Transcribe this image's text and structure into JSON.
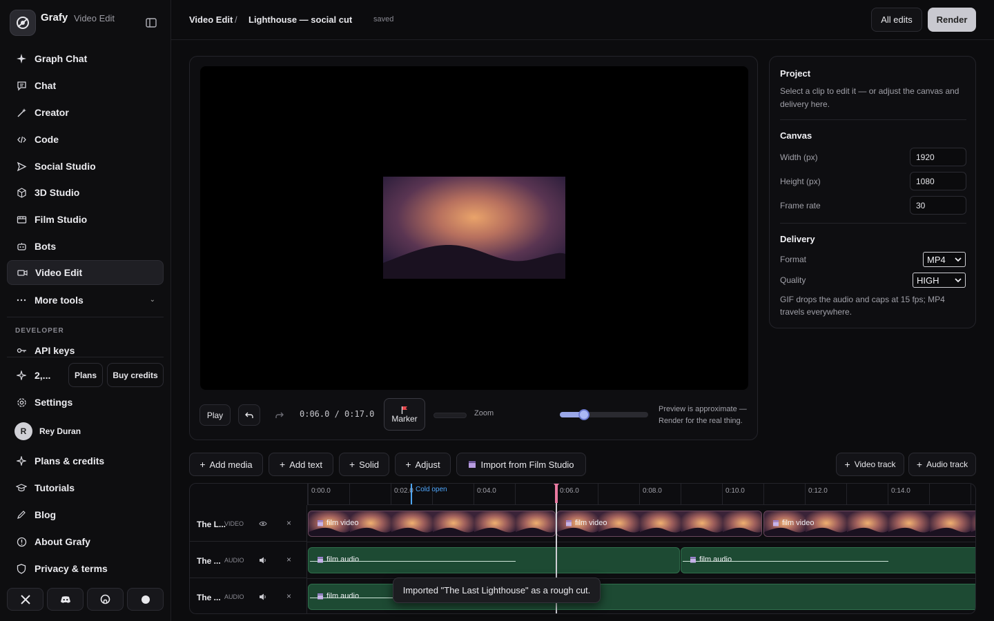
{
  "brand": {
    "name": "Grafy",
    "subtitle": "Video Edit"
  },
  "sidebar": {
    "items": [
      {
        "label": "Graph Chat",
        "icon": "sparkle-icon"
      },
      {
        "label": "Chat",
        "icon": "chat-icon"
      },
      {
        "label": "Creator",
        "icon": "wand-icon"
      },
      {
        "label": "Code",
        "icon": "code-icon"
      },
      {
        "label": "Social Studio",
        "icon": "send-icon"
      },
      {
        "label": "3D Studio",
        "icon": "cube-icon"
      },
      {
        "label": "Film Studio",
        "icon": "film-icon"
      },
      {
        "label": "Bots",
        "icon": "bot-icon"
      },
      {
        "label": "Video Edit",
        "icon": "video-icon",
        "active": true
      },
      {
        "label": "More tools",
        "icon": "dots-icon"
      }
    ],
    "developer_label": "DEVELOPER",
    "api_keys": "API keys",
    "credits": "2,...",
    "plans_button": "Plans",
    "buy_credits_button": "Buy credits",
    "settings": "Settings",
    "user": {
      "initial": "R",
      "name": "Rey Duran"
    },
    "bottom_items": [
      "Plans & credits",
      "Tutorials",
      "Blog",
      "About Grafy",
      "Privacy & terms"
    ]
  },
  "header": {
    "crumb_root": "Video Edit",
    "separator": "/",
    "project_title": "Lighthouse — social cut",
    "status": "saved",
    "all_edits": "All edits",
    "render": "Render"
  },
  "preview": {
    "play": "Play",
    "timecode": "0:06.0 / 0:17.0",
    "marker": "Marker",
    "zoom": "Zoom",
    "zoom_level": 0.27,
    "note": "Preview is approximate — Render for the real thing."
  },
  "project": {
    "title": "Project",
    "description": "Select a clip to edit it — or adjust the canvas and delivery here.",
    "canvas_title": "Canvas",
    "width_label": "Width (px)",
    "width_value": "1920",
    "height_label": "Height (px)",
    "height_value": "1080",
    "fps_label": "Frame rate",
    "fps_value": "30",
    "delivery_title": "Delivery",
    "format_label": "Format",
    "format_value": "MP4",
    "quality_label": "Quality",
    "quality_value": "HIGH",
    "delivery_note": "GIF drops the audio and caps at 15 fps; MP4 travels everywhere."
  },
  "toolbar": {
    "add_media": "Add media",
    "add_text": "Add text",
    "solid": "Solid",
    "adjust": "Adjust",
    "import": "Import from Film Studio",
    "video_track": "Video track",
    "audio_track": "Audio track"
  },
  "timeline": {
    "ticks": [
      "0:00.0",
      "0:02.0",
      "0:04.0",
      "0:06.0",
      "0:08.0",
      "0:10.0",
      "0:12.0",
      "0:14.0"
    ],
    "marker_label": "Cold open",
    "tracks": [
      {
        "name": "The L...",
        "type": "VIDEO",
        "clips": [
          "film video",
          "film video",
          "film video"
        ]
      },
      {
        "name": "The ...",
        "type": "AUDIO",
        "clips": [
          "film audio",
          "film audio"
        ]
      },
      {
        "name": "The ...",
        "type": "AUDIO",
        "clips": [
          "film audio"
        ]
      }
    ]
  },
  "toast": "Imported \"The Last Lighthouse\" as a rough cut.",
  "colors": {
    "accent": "#aab8f5",
    "playhead": "#e879a0",
    "marker": "#4fa8ff",
    "video_clip": "#3a2338",
    "audio_clip": "#1d4a33"
  }
}
